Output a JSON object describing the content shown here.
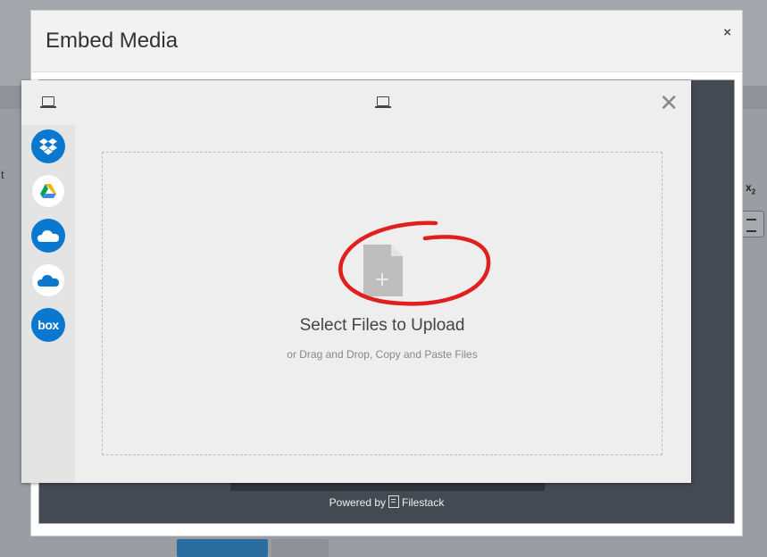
{
  "background": {
    "left_text": "t",
    "toolbar_subscript": {
      "base": "x",
      "sub": "2"
    }
  },
  "modal": {
    "title": "Embed Media",
    "close_glyph": "×"
  },
  "picker": {
    "close_glyph": "✕",
    "header_icon": "laptop-icon",
    "sources": [
      {
        "name": "Dropbox",
        "icon": "dropbox-icon"
      },
      {
        "name": "Google Drive",
        "icon": "google-drive-icon"
      },
      {
        "name": "OneDrive",
        "icon": "onedrive-icon"
      },
      {
        "name": "OneDrive for Business",
        "icon": "onedrive-business-icon"
      },
      {
        "name": "Box",
        "icon": "box-icon",
        "label": "box"
      }
    ],
    "dropzone": {
      "title": "Select Files to Upload",
      "subtitle": "or Drag and Drop, Copy and Paste Files",
      "file_icon_glyph": "+"
    }
  },
  "footer": {
    "powered_prefix": "Powered by",
    "brand": "Filestack"
  },
  "colors": {
    "source_blue": "#0b78d0",
    "annotation_red": "#e01f1f",
    "file_icon_gray": "#bdbdbd"
  }
}
